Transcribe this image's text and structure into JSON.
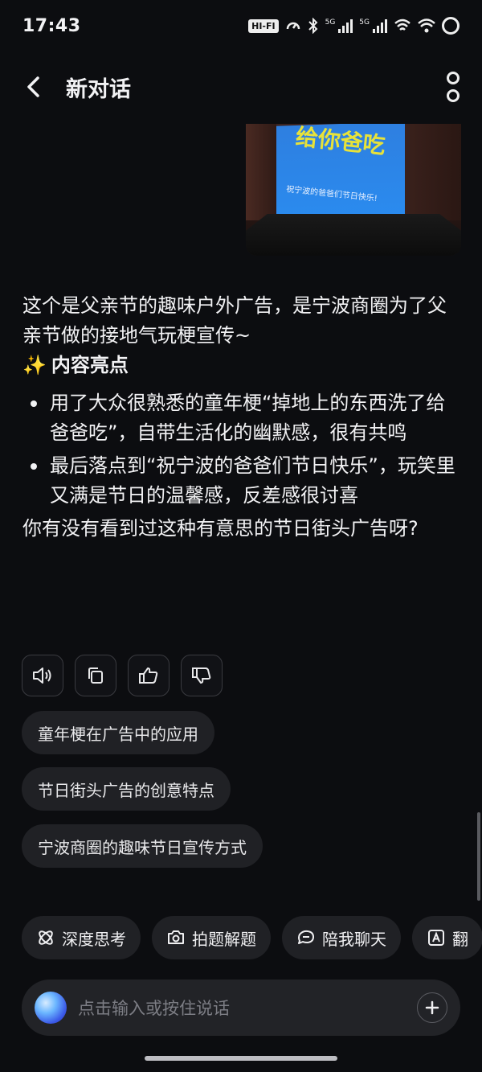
{
  "status_bar": {
    "time": "17:43",
    "hifi": "HI-FI",
    "sim1": "5G",
    "sim2": "5G"
  },
  "header": {
    "title": "新对话"
  },
  "image_card": {
    "headline_text": "给你爸吃",
    "caption_text": "祝宁波的爸爸们节日快乐!"
  },
  "reply": {
    "intro": "这个是父亲节的趣味户外广告，是宁波商圈为了父亲节做的接地气玩梗宣传~",
    "highlight_emoji": "✨",
    "highlight_title": "内容亮点",
    "points": [
      "用了大众很熟悉的童年梗“掉地上的东西洗了给爸爸吃”，自带生活化的幽默感，很有共鸣",
      "最后落点到“祝宁波的爸爸们节日快乐”，玩笑里又满是节日的温馨感，反差感很讨喜"
    ],
    "question": "你有没有看到过这种有意思的节日街头广告呀?"
  },
  "actions": [
    {
      "name": "speaker-icon"
    },
    {
      "name": "copy-icon"
    },
    {
      "name": "thumbs-up-icon"
    },
    {
      "name": "thumbs-down-icon"
    }
  ],
  "suggestions": [
    "童年梗在广告中的应用",
    "节日街头广告的创意特点",
    "宁波商圈的趣味节日宣传方式"
  ],
  "tools": [
    {
      "label": "深度思考",
      "icon": "atom-icon"
    },
    {
      "label": "拍题解题",
      "icon": "camera-icon"
    },
    {
      "label": "陪我聊天",
      "icon": "chat-bubble-icon"
    },
    {
      "label": "翻",
      "icon": "translate-icon"
    }
  ],
  "input": {
    "placeholder": "点击输入或按住说话"
  }
}
